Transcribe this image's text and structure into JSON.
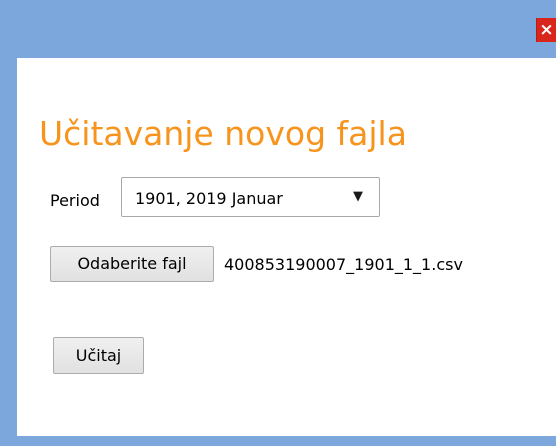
{
  "dialog": {
    "close_glyph": "×",
    "heading": "Učitavanje novog fajla",
    "period": {
      "label": "Period",
      "selected": "1901, 2019 Januar",
      "chevron_glyph": "▼"
    },
    "file": {
      "button_label": "Odaberite fajl",
      "selected_name": "400853190007_1901_1_1.csv"
    },
    "load_button_label": "Učitaj"
  },
  "colors": {
    "titlebar": "#7ba7dd",
    "heading": "#f7941d",
    "close": "#d9261c"
  }
}
